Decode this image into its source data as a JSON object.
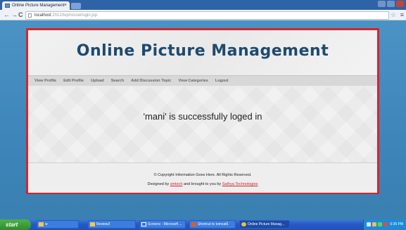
{
  "browser": {
    "tab_title": "Online Picture Management",
    "tab_close": "×",
    "back_icon": "←",
    "forward_icon": "→",
    "reload_icon": "C",
    "url_host": "localhost",
    "url_path": ":2012/topm/userlogin.jsp",
    "star_icon": "☆",
    "wrench_icon": "≡"
  },
  "site": {
    "title": "Online Picture Management",
    "menu": [
      "View Profile",
      "Edit Profile",
      "Upload",
      "Search",
      "Add Discussion Topic",
      "View Categories",
      "Logout"
    ],
    "message": "'mani' is successfully loged in",
    "footer_line1": "© Copyright Information Goes Here. All Rights Reserved.",
    "footer_designed_prefix": "Designed by ",
    "footer_designer": "smtech",
    "footer_middle": " and brought to you by ",
    "footer_company": "Sathya Technologies"
  },
  "taskbar": {
    "start_label": "start",
    "items": [
      "w",
      "Review3",
      "Screenc - Microsoft ...",
      "Shortcut to tomcat6",
      "Online Picture Manag..."
    ],
    "time": "6:35 PM"
  },
  "colors": {
    "frame_border": "#d9232a",
    "title_color": "#1e4a6e",
    "link_red": "#d0262d",
    "taskbar_blue": "#2557c4",
    "start_green": "#2f8d2a"
  }
}
